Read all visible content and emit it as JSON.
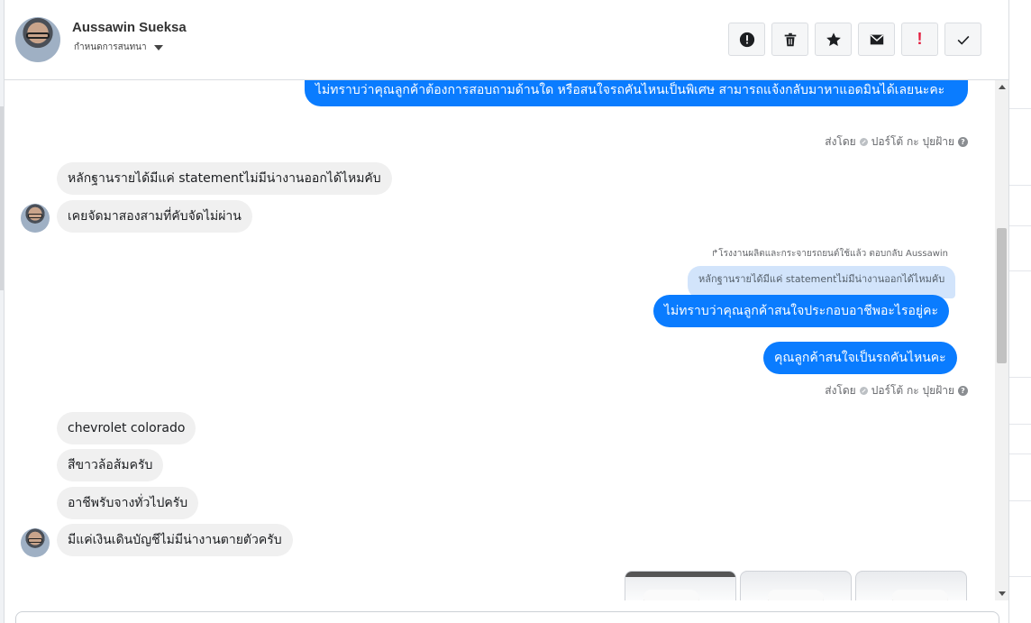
{
  "header": {
    "user_name": "Aussawin Sueksa",
    "assign_label": "กำหนดการสนทนา",
    "actions": [
      {
        "icon": "alert-circle-icon"
      },
      {
        "icon": "trash-icon"
      },
      {
        "icon": "star-icon"
      },
      {
        "icon": "mail-icon"
      },
      {
        "icon": "exclamation-icon",
        "label": "!"
      },
      {
        "icon": "check-icon"
      }
    ]
  },
  "messages": {
    "m1": "ไม่ทราบว่าคุณลูกค้าต้องการสอบถามด้านใด หรือสนใจรถคันไหนเป็นพิเศษ สามารถแจ้งกลับมาหาแอดมินได้เลยนะคะ",
    "sent_by_1": "ส่งโดย",
    "sender_1": "ปอร์โต้ กะ ปุยฝ้าย",
    "m2": "หลักฐานรายได้มีแค่ statementไม่มีน่างานออกได้ไหมคับ",
    "m3": "เคยจัดมาสองสามที่คับจัดไม่ผ่าน",
    "reply_note": "โรงงานผลิตและกระจายรถยนต์ใช้แล้ว ตอบกลับ Aussawin",
    "quote": "หลักฐานรายได้มีแค่ statementไม่มีน่างานออกได้ไหมคับ",
    "m4": "ไม่ทราบว่าคุณลูกค้าสนใจประกอบอาชีพอะไรอยู่คะ",
    "m5": "คุณลูกค้าสนใจเป็นรถคันไหนคะ",
    "sent_by_2": "ส่งโดย",
    "sender_2": "ปอร์โต้ กะ ปุยฝ้าย",
    "m6": "chevrolet colorado",
    "m7": "สีขาวล้อส้มครับ",
    "m8": "อาชีพรับจางทั่วไปครับ",
    "m9": "มีแค่เงินเดินบัญชีไม่มีน่างานตายตัวครับ"
  },
  "colors": {
    "outgoing": "#0a7cff",
    "incoming": "#f0f0f0",
    "quote": "#d2e4fb",
    "danger": "#e41e3f"
  }
}
